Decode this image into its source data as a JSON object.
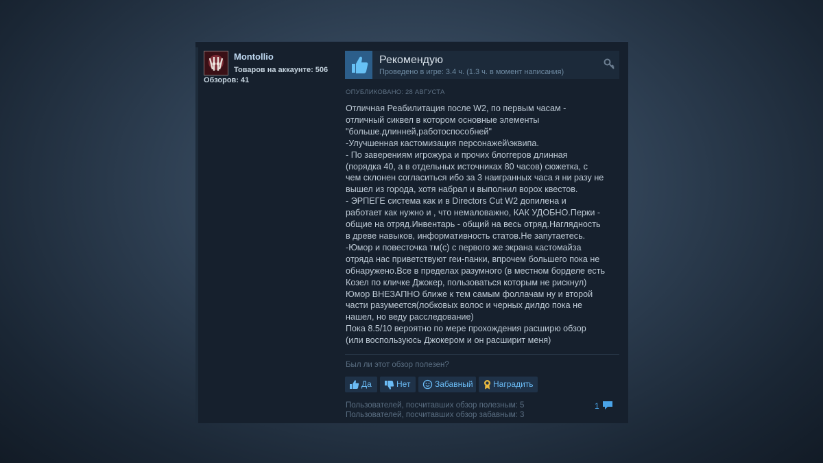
{
  "author": {
    "name": "Montollio",
    "products_label": "Товаров на аккаунте: 506",
    "reviews_label": "Обзоров: 41"
  },
  "review": {
    "verdict": "Рекомендую",
    "playtime": "Проведено в игре: 3.4 ч. (1.3 ч. в момент написания)",
    "posted": "ОПУБЛИКОВАНО: 28 АВГУСТА",
    "body_lines": [
      "Отличная Реабилитация после W2, по первым часам -",
      "отличный сиквел в котором основные элементы",
      "\"больше.длинней,работоспособней\"",
      "-Улучшенная кастомизация персонажей\\эквипа.",
      "- По заверениям игрожура и прочих блоггеров длинная",
      "(порядка 40, а в отдельных источниках 80 часов) сюжетка, с",
      "чем склонен согласиться ибо за 3 наигранных часа я ни разу не",
      "вышел из города, хотя набрал и выполнил ворох квестов.",
      "- ЭРПЕГЕ система как и в Directors Cut W2 допилена и",
      "работает как нужно и , что немаловажно, КАК УДОБНО.Перки -",
      "общие на отряд.Инвентарь - общий на весь отряд.Наглядность",
      "в древе навыков, информативность статов.Не запутаетесь.",
      "-Юмор и повесточка тм(с) с первого же экрана кастомайза",
      "отряда нас приветствуют геи-панки, впрочем большего пока не",
      "обнаружено.Все в пределах разумного (в местном борделе есть",
      "Козел по кличке Джокер, пользоваться которым не рискнул)",
      "Юмор ВНЕЗАПНО ближе к тем самым фоллачам ну и второй",
      "части разумеется(лобковых волос и черных дилдо пока не",
      "нашел, но веду расследование)",
      "Пока 8.5/10 вероятно по мере прохождения расширю обзор",
      "(или воспользуюсь Джокером и он расширит меня)"
    ]
  },
  "feedback": {
    "question": "Был ли этот обзор полезен?",
    "yes": "Да",
    "no": "Нет",
    "funny": "Забавный",
    "award": "Наградить",
    "helpful_count": "Пользователей, посчитавших обзор полезным: 5",
    "funny_count": "Пользователей, посчитавших обзор забавным: 3",
    "comments_count": "1"
  },
  "colors": {
    "accent": "#66c0f4",
    "card_bg": "#16202d",
    "thumb_bg": "#2c5e8a"
  },
  "icons": {
    "thumb": "thumbs-up-icon",
    "key": "key-icon",
    "yes": "thumbs-up-icon",
    "no": "thumbs-down-icon",
    "funny": "smiley-icon",
    "award": "award-icon",
    "comment": "comment-icon"
  }
}
